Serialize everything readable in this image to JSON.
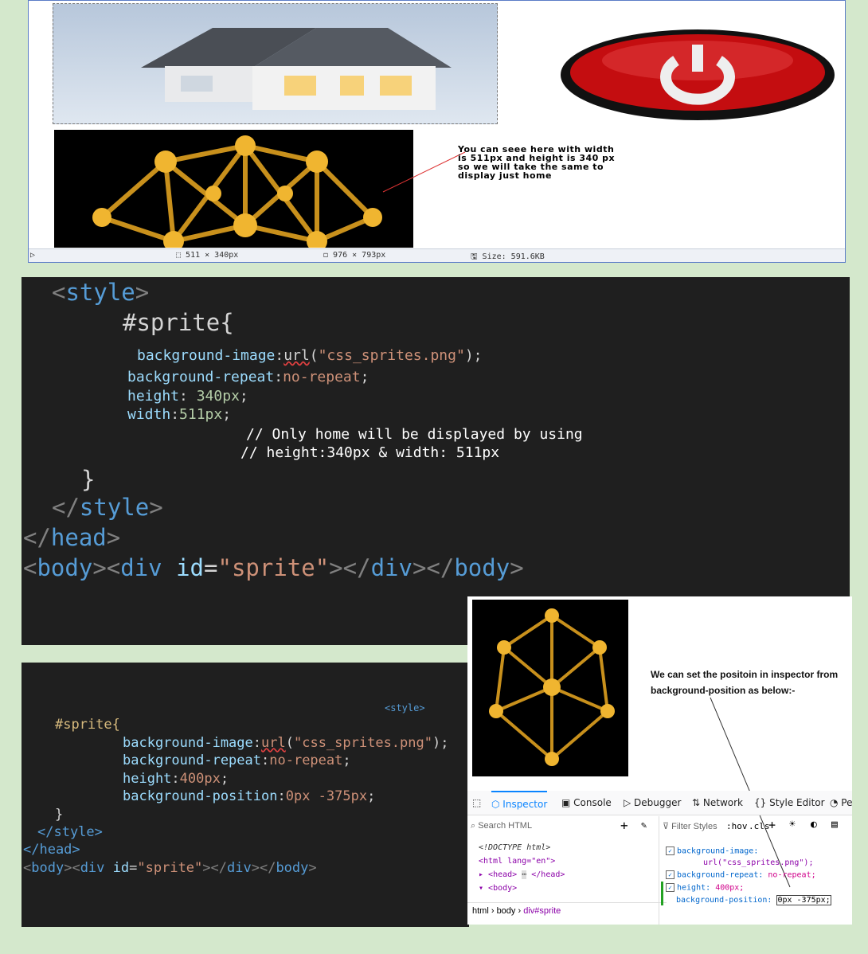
{
  "viewer": {
    "note_lines": [
      "You can seee here with width",
      "is 511px and height is 340 px",
      "so we will take the same to",
      "display just home"
    ],
    "status": {
      "selection": "511 × 340px",
      "image_size": "976 × 793px",
      "file_size": "Size: 591.6KB"
    }
  },
  "code1": {
    "l1": "<style>",
    "l2": "#sprite{",
    "l3_prop": "background-image",
    "l3_fn": "url",
    "l3_str": "\"css_sprites.png\"",
    "l4_prop": "background-repeat",
    "l4_val": "no-repeat",
    "l5_prop": "height",
    "l5_val": "340px",
    "l6_prop": "width",
    "l6_val": "511px",
    "c1": "// Only home will be displayed by using",
    "c2": "// height:340px & width: 511px",
    "l7": "}",
    "l8": "</style>",
    "l9": "</head>",
    "l10_body": "body",
    "l10_div": "div",
    "l10_attr": "id",
    "l10_str": "\"sprite\""
  },
  "code2": {
    "style_tag": "<style>",
    "sel": "#sprite{",
    "p1": "background-image",
    "p1_fn": "url",
    "p1_str": "\"css_sprites.png\"",
    "p2": "background-repeat",
    "p2_val": "no-repeat",
    "p3": "height",
    "p3_val": "400px",
    "p4": "background-position",
    "p4_val": "0px -375px",
    "close": "}",
    "end_style": "</style>",
    "end_head": "</head>",
    "body_tag": "body",
    "div_tag": "div",
    "attr": "id",
    "attr_val": "\"sprite\""
  },
  "inspector": {
    "note": "We can set the positoin in inspector from background-position as below:-",
    "tabs": [
      "Inspector",
      "Console",
      "Debugger",
      "Network",
      "Style Editor",
      "Pe"
    ],
    "search_placeholder": "Search HTML",
    "filter_placeholder": "Filter Styles",
    "hov": ":hov",
    "cls": ".cls",
    "html_lines": [
      "<!DOCTYPE html>",
      "<html lang=\"en\">",
      "<head>",
      "</head>",
      "<body>"
    ],
    "breadcrumb": [
      "html",
      "body",
      "div#sprite"
    ],
    "rules": [
      {
        "prop": "background-image:",
        "val": ""
      },
      {
        "prop": "",
        "val": "url(\"css_sprites.png\");"
      },
      {
        "prop": "background-repeat:",
        "val": "no-repeat;"
      },
      {
        "prop": "height:",
        "val": "400px;"
      },
      {
        "prop": "background-position:",
        "val": "0px -375px;"
      }
    ]
  }
}
